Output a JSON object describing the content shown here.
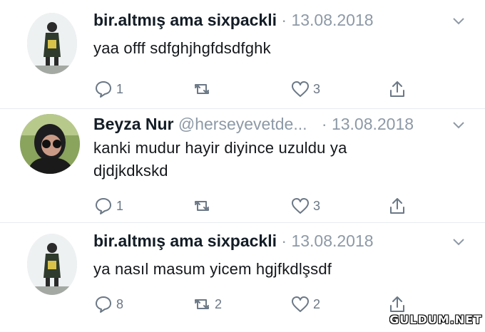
{
  "tweets": [
    {
      "name": "bir.altmış ama sixpackli",
      "handle": "",
      "date": "13.08.2018",
      "text_lines": [
        "yaa offf sdfghjhgfdsdfghk"
      ],
      "replies": "1",
      "retweets": "",
      "likes": "3"
    },
    {
      "name": "Beyza Nur",
      "handle": "@herseyevetde...",
      "date": "13.08.2018",
      "text_lines": [
        "kanki mudur hayir diyince uzuldu ya",
        "djdjkdkskd"
      ],
      "replies": "1",
      "retweets": "",
      "likes": "3"
    },
    {
      "name": "bir.altmış ama sixpackli",
      "handle": "",
      "date": "13.08.2018",
      "text_lines": [
        "ya nasıl masum yicem hgjfkdlşsdf"
      ],
      "replies": "8",
      "retweets": "2",
      "likes": "2"
    }
  ],
  "separator": "·",
  "watermark": "GULDUM.NET",
  "colors": {
    "muted": "#8d99a6",
    "icon": "#6b7886",
    "name": "#141d26"
  },
  "icons": [
    "reply-icon",
    "retweet-icon",
    "like-icon",
    "share-icon",
    "chevron-down-icon"
  ]
}
